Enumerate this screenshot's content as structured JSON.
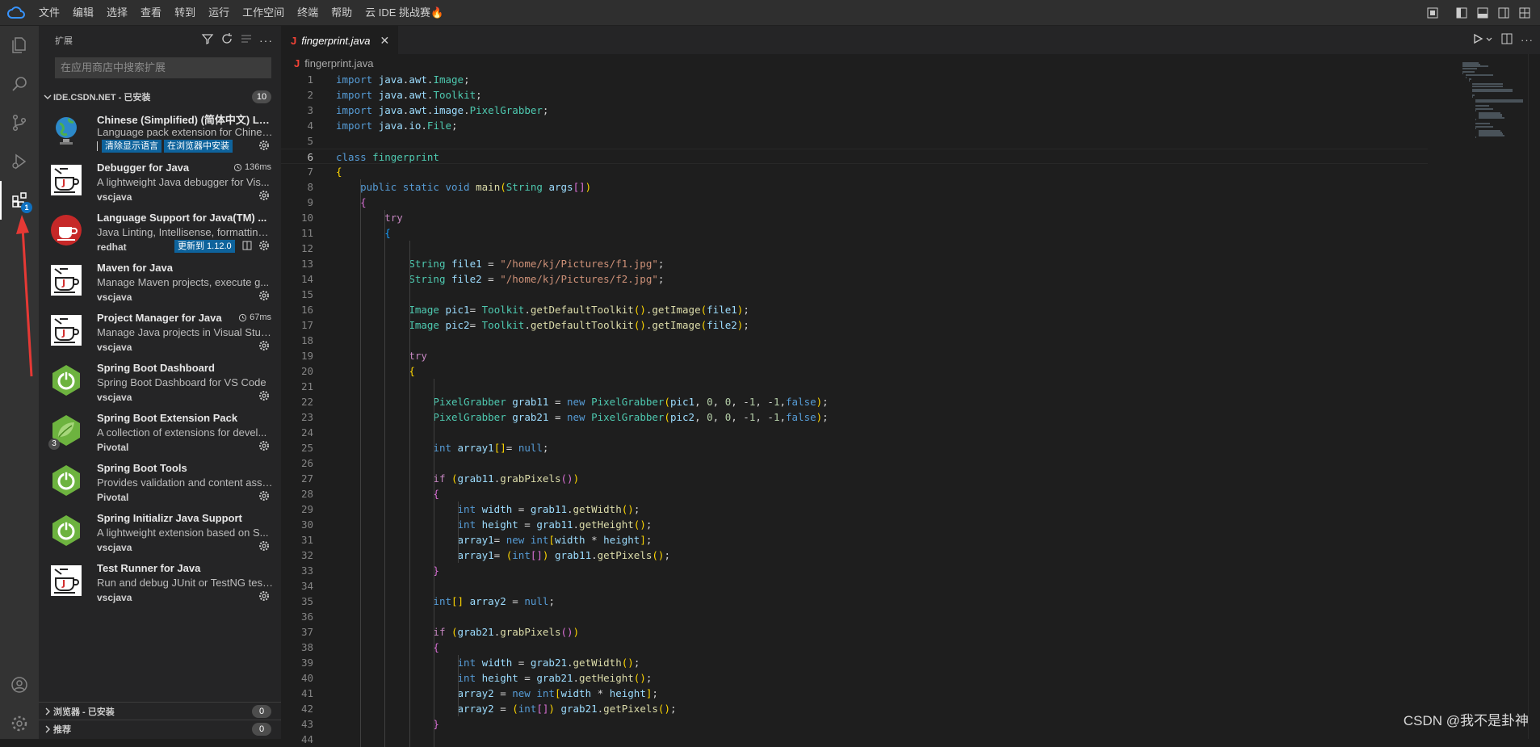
{
  "menu": [
    "文件",
    "编辑",
    "选择",
    "查看",
    "转到",
    "运行",
    "工作空间",
    "终端",
    "帮助",
    "云 IDE 挑战赛🔥"
  ],
  "activity": {
    "extensions_badge": "1"
  },
  "sidebar": {
    "title": "扩展",
    "search_placeholder": "在应用商店中搜索扩展",
    "section_installed": "IDE.CSDN.NET - 已安装",
    "section_installed_count": "10",
    "section_browser": "浏览器 - 已安装",
    "section_browser_count": "0",
    "section_recommended": "推荐",
    "section_recommended_count": "0",
    "extensions": [
      {
        "name": "Chinese (Simplified) (简体中文) La...",
        "desc": "Language pack extension for Chines...",
        "pills": [
          "清除显示语言",
          "在浏览器中安装"
        ]
      },
      {
        "name": "Debugger for Java",
        "desc": "A lightweight Java debugger for Vis...",
        "publisher": "vscjava",
        "time": "136ms"
      },
      {
        "name": "Language Support for Java(TM) ...",
        "desc": "Java Linting, Intellisense, formatting,...",
        "publisher": "redhat",
        "pills": [
          "更新到 1.12.0"
        ]
      },
      {
        "name": "Maven for Java",
        "desc": "Manage Maven projects, execute g...",
        "publisher": "vscjava"
      },
      {
        "name": "Project Manager for Java",
        "desc": "Manage Java projects in Visual Stud...",
        "publisher": "vscjava",
        "time": "67ms"
      },
      {
        "name": "Spring Boot Dashboard",
        "desc": "Spring Boot Dashboard for VS Code",
        "publisher": "vscjava"
      },
      {
        "name": "Spring Boot Extension Pack",
        "desc": "A collection of extensions for devel...",
        "publisher": "Pivotal",
        "icon_badge": "3"
      },
      {
        "name": "Spring Boot Tools",
        "desc": "Provides validation and content assi...",
        "publisher": "Pivotal"
      },
      {
        "name": "Spring Initializr Java Support",
        "desc": "A lightweight extension based on S...",
        "publisher": "vscjava"
      },
      {
        "name": "Test Runner for Java",
        "desc": "Run and debug JUnit or TestNG test...",
        "publisher": "vscjava"
      }
    ]
  },
  "editor": {
    "tab_label": "fingerprint.java",
    "breadcrumb": "fingerprint.java",
    "current_line": 6,
    "lines": [
      "import java.awt.Image;",
      "import java.awt.Toolkit;",
      "import java.awt.image.PixelGrabber;",
      "import java.io.File;",
      "",
      "class fingerprint",
      "{",
      "    public static void main(String args[])",
      "    {",
      "        try",
      "        {",
      "",
      "            String file1 = \"/home/kj/Pictures/f1.jpg\";",
      "            String file2 = \"/home/kj/Pictures/f2.jpg\";",
      "",
      "            Image pic1= Toolkit.getDefaultToolkit().getImage(file1);",
      "            Image pic2= Toolkit.getDefaultToolkit().getImage(file2);",
      "",
      "            try",
      "            {",
      "",
      "                PixelGrabber grab11 = new PixelGrabber(pic1, 0, 0, -1, -1,false);",
      "                PixelGrabber grab21 = new PixelGrabber(pic2, 0, 0, -1, -1,false);",
      "",
      "                int array1[]= null;",
      "",
      "                if (grab11.grabPixels())",
      "                {",
      "                    int width = grab11.getWidth();",
      "                    int height = grab11.getHeight();",
      "                    array1= new int[width * height];",
      "                    array1= (int[]) grab11.getPixels();",
      "                }",
      "",
      "                int[] array2 = null;",
      "",
      "                if (grab21.grabPixels())",
      "                {",
      "                    int width = grab21.getWidth();",
      "                    int height = grab21.getHeight();",
      "                    array2 = new int[width * height];",
      "                    array2 = (int[]) grab21.getPixels();",
      "                }",
      ""
    ]
  },
  "watermark": "CSDN @我不是卦神",
  "colors": {
    "accent": "#0e639c",
    "activity_badge": "#0e70c0",
    "annotation_arrow": "#e53935"
  }
}
